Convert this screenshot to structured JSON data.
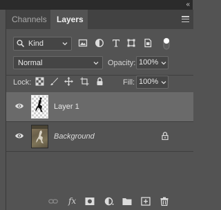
{
  "window": {
    "collapse_glyph": "«",
    "close_glyph": "×"
  },
  "tabs": [
    {
      "label": "Channels",
      "active": false
    },
    {
      "label": "Layers",
      "active": true
    }
  ],
  "filter": {
    "kind_label": "Kind",
    "icons": [
      "image-filter-icon",
      "adjustment-filter-icon",
      "type-filter-icon",
      "shape-filter-icon",
      "smart-object-filter-icon"
    ]
  },
  "blend": {
    "mode": "Normal",
    "opacity_label": "Opacity:",
    "opacity_value": "100%"
  },
  "lock": {
    "label": "Lock:",
    "icons": [
      "lock-transparent-pixels-icon",
      "lock-image-pixels-icon",
      "lock-position-icon",
      "lock-artboard-icon",
      "lock-all-icon"
    ],
    "fill_label": "Fill:",
    "fill_value": "100%"
  },
  "layers": [
    {
      "name": "Layer 1",
      "visible": true,
      "selected": true,
      "locked": false
    },
    {
      "name": "Background",
      "visible": true,
      "selected": false,
      "locked": true
    }
  ],
  "bottom_bar": {
    "fx_label": "fx",
    "icons": [
      "link-layers-icon",
      "add-style-icon",
      "add-mask-icon",
      "new-fill-adjustment-icon",
      "new-group-icon",
      "new-layer-icon",
      "delete-layer-icon"
    ]
  },
  "colors": {
    "panel_bg": "#535353",
    "tabbar_bg": "#424242",
    "selected_row": "#6a6a6a",
    "input_bg": "#454545"
  }
}
